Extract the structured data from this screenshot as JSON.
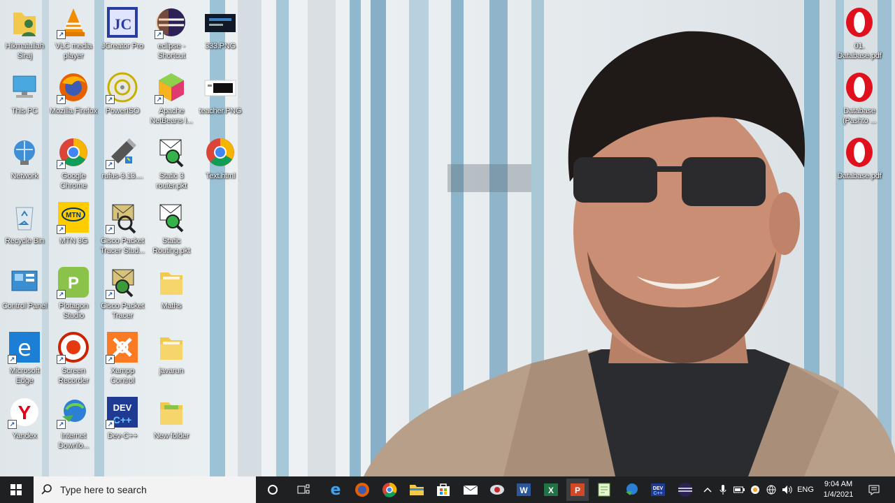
{
  "desktop": {
    "icons": [
      {
        "label": "Hikmatullah Siraj",
        "icon": "folder-user-icon"
      },
      {
        "label": "VLC media player",
        "icon": "vlc-icon"
      },
      {
        "label": "JCreator Pro",
        "icon": "jcreator-icon"
      },
      {
        "label": "eclipse - Shortcut",
        "icon": "eclipse-icon"
      },
      {
        "label": "333.PNG",
        "icon": "image-file-icon"
      },
      {
        "label": "This PC",
        "icon": "computer-icon"
      },
      {
        "label": "Mozilla Firefox",
        "icon": "firefox-icon"
      },
      {
        "label": "PowerISO",
        "icon": "poweriso-icon"
      },
      {
        "label": "Apache NetBeans I...",
        "icon": "netbeans-icon"
      },
      {
        "label": "teacher.PNG",
        "icon": "image-file-icon"
      },
      {
        "label": "Network",
        "icon": "network-icon"
      },
      {
        "label": "Google Chrome",
        "icon": "chrome-icon"
      },
      {
        "label": "rufus-3.13....",
        "icon": "rufus-usb-icon"
      },
      {
        "label": "Static 3 router.pkt",
        "icon": "packet-tracer-file-icon"
      },
      {
        "label": "Text.html",
        "icon": "chrome-icon"
      },
      {
        "label": "Recycle Bin",
        "icon": "recycle-bin-icon"
      },
      {
        "label": "MTN 3G",
        "icon": "mtn-icon"
      },
      {
        "label": "Cisco Packet Tracer Stud...",
        "icon": "cisco-packet-tracer-icon"
      },
      {
        "label": "Static Routing.pkt",
        "icon": "packet-tracer-file-icon"
      },
      {
        "label": "Control Panel",
        "icon": "control-panel-icon"
      },
      {
        "label": "Plotagon Studio",
        "icon": "plotagon-icon"
      },
      {
        "label": "Cisco Packet Tracer",
        "icon": "cisco-packet-tracer-icon"
      },
      {
        "label": "Maths",
        "icon": "folder-icon"
      },
      {
        "label": "Microsoft Edge",
        "icon": "edge-icon"
      },
      {
        "label": "Screen Recorder",
        "icon": "screen-recorder-icon"
      },
      {
        "label": "Xampp Control",
        "icon": "xampp-icon"
      },
      {
        "label": "javarun",
        "icon": "folder-icon"
      },
      {
        "label": "Yandex",
        "icon": "yandex-icon"
      },
      {
        "label": "Internet Downlo...",
        "icon": "internet-download-manager-icon"
      },
      {
        "label": "Dev-C++",
        "icon": "dev-cpp-icon"
      },
      {
        "label": "New folder",
        "icon": "folder-icon"
      },
      {
        "label": "01. Database.pdf",
        "icon": "opera-pdf-icon"
      },
      {
        "label": "Database (Pashto ...",
        "icon": "opera-pdf-icon"
      },
      {
        "label": "Database.pdf",
        "icon": "opera-pdf-icon"
      }
    ]
  },
  "taskbar": {
    "search_placeholder": "Type here to search",
    "pinned": [
      "edge-icon",
      "firefox-icon",
      "chrome-icon",
      "file-explorer-icon",
      "store-icon",
      "mail-icon",
      "screen-recorder-icon",
      "word-icon",
      "excel-icon",
      "powerpoint-icon",
      "notepad-plus-icon",
      "internet-download-manager-icon",
      "dev-cpp-icon",
      "eclipse-icon"
    ],
    "tray": {
      "language": "ENG",
      "time": "9:04 AM",
      "date": "1/4/2021"
    }
  },
  "colors": {
    "taskbar_bg": "#1f2022",
    "search_bg": "#f3f3f3",
    "opera_red": "#e0101c",
    "folder_yellow": "#f2c94c"
  }
}
